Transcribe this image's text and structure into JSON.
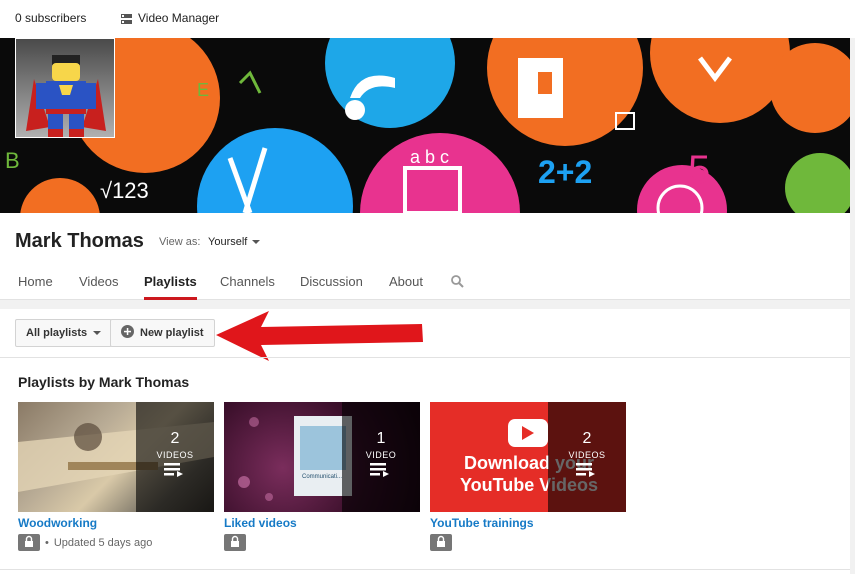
{
  "topbar": {
    "subscribers": "0 subscribers",
    "video_manager": "Video Manager"
  },
  "banner": {
    "text_e": "E",
    "text_b": "B",
    "text_sqrt": "√123",
    "text_abc": "a b c",
    "text_22": "2+2",
    "text_5": "5"
  },
  "channel": {
    "name": "Mark Thomas",
    "view_as_label": "View as:",
    "view_as_value": "Yourself"
  },
  "tabs": [
    {
      "label": "Home"
    },
    {
      "label": "Videos"
    },
    {
      "label": "Playlists"
    },
    {
      "label": "Channels"
    },
    {
      "label": "Discussion"
    },
    {
      "label": "About"
    }
  ],
  "toolbar": {
    "all_playlists": "All playlists",
    "new_playlist": "New playlist"
  },
  "section_title": "Playlists by Mark Thomas",
  "playlists": [
    {
      "title": "Woodworking",
      "count": "2",
      "videos_label": "VIDEOS",
      "updated": "Updated 5 days ago"
    },
    {
      "title": "Liked videos",
      "count": "1",
      "videos_label": "VIDEO",
      "thumb_text": "Communicati..."
    },
    {
      "title": "YouTube trainings",
      "count": "2",
      "videos_label": "VIDEOS",
      "thumb_text": "Download your YouTube Videos"
    }
  ],
  "colors": {
    "accent_red": "#cc181e",
    "link_blue": "#167ac6",
    "arrow_red": "#e0161b"
  }
}
